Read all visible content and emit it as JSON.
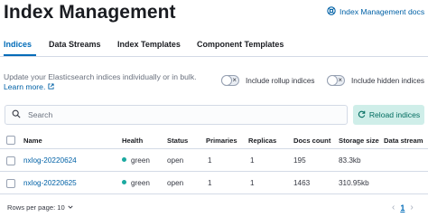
{
  "header": {
    "title": "Index Management",
    "docs_link": "Index Management docs"
  },
  "tabs": [
    {
      "label": "Indices",
      "active": true
    },
    {
      "label": "Data Streams",
      "active": false
    },
    {
      "label": "Index Templates",
      "active": false
    },
    {
      "label": "Component Templates",
      "active": false
    }
  ],
  "description": {
    "text": "Update your Elasticsearch indices individually or in bulk.",
    "learn_more": "Learn more."
  },
  "toggles": {
    "rollup": {
      "label": "Include rollup indices",
      "on": false
    },
    "hidden": {
      "label": "Include hidden indices",
      "on": false
    }
  },
  "search": {
    "placeholder": "Search",
    "icon": "search-icon"
  },
  "reload_button": {
    "label": "Reload indices",
    "icon": "refresh-icon"
  },
  "table": {
    "columns": [
      "Name",
      "Health",
      "Status",
      "Primaries",
      "Replicas",
      "Docs count",
      "Storage size",
      "Data stream"
    ],
    "rows": [
      {
        "name": "nxlog-20220624",
        "health": "green",
        "status": "open",
        "primaries": "1",
        "replicas": "1",
        "docs_count": "195",
        "storage_size": "83.3kb",
        "data_stream": ""
      },
      {
        "name": "nxlog-20220625",
        "health": "green",
        "status": "open",
        "primaries": "1",
        "replicas": "1",
        "docs_count": "1463",
        "storage_size": "310.95kb",
        "data_stream": ""
      }
    ]
  },
  "footer": {
    "rows_per_page": "Rows per page: 10",
    "current_page": "1"
  },
  "colors": {
    "accent": "#006bb8",
    "link": "#0061a6",
    "health_green": "#1ba9a0",
    "reload_bg": "#cfeee9"
  }
}
